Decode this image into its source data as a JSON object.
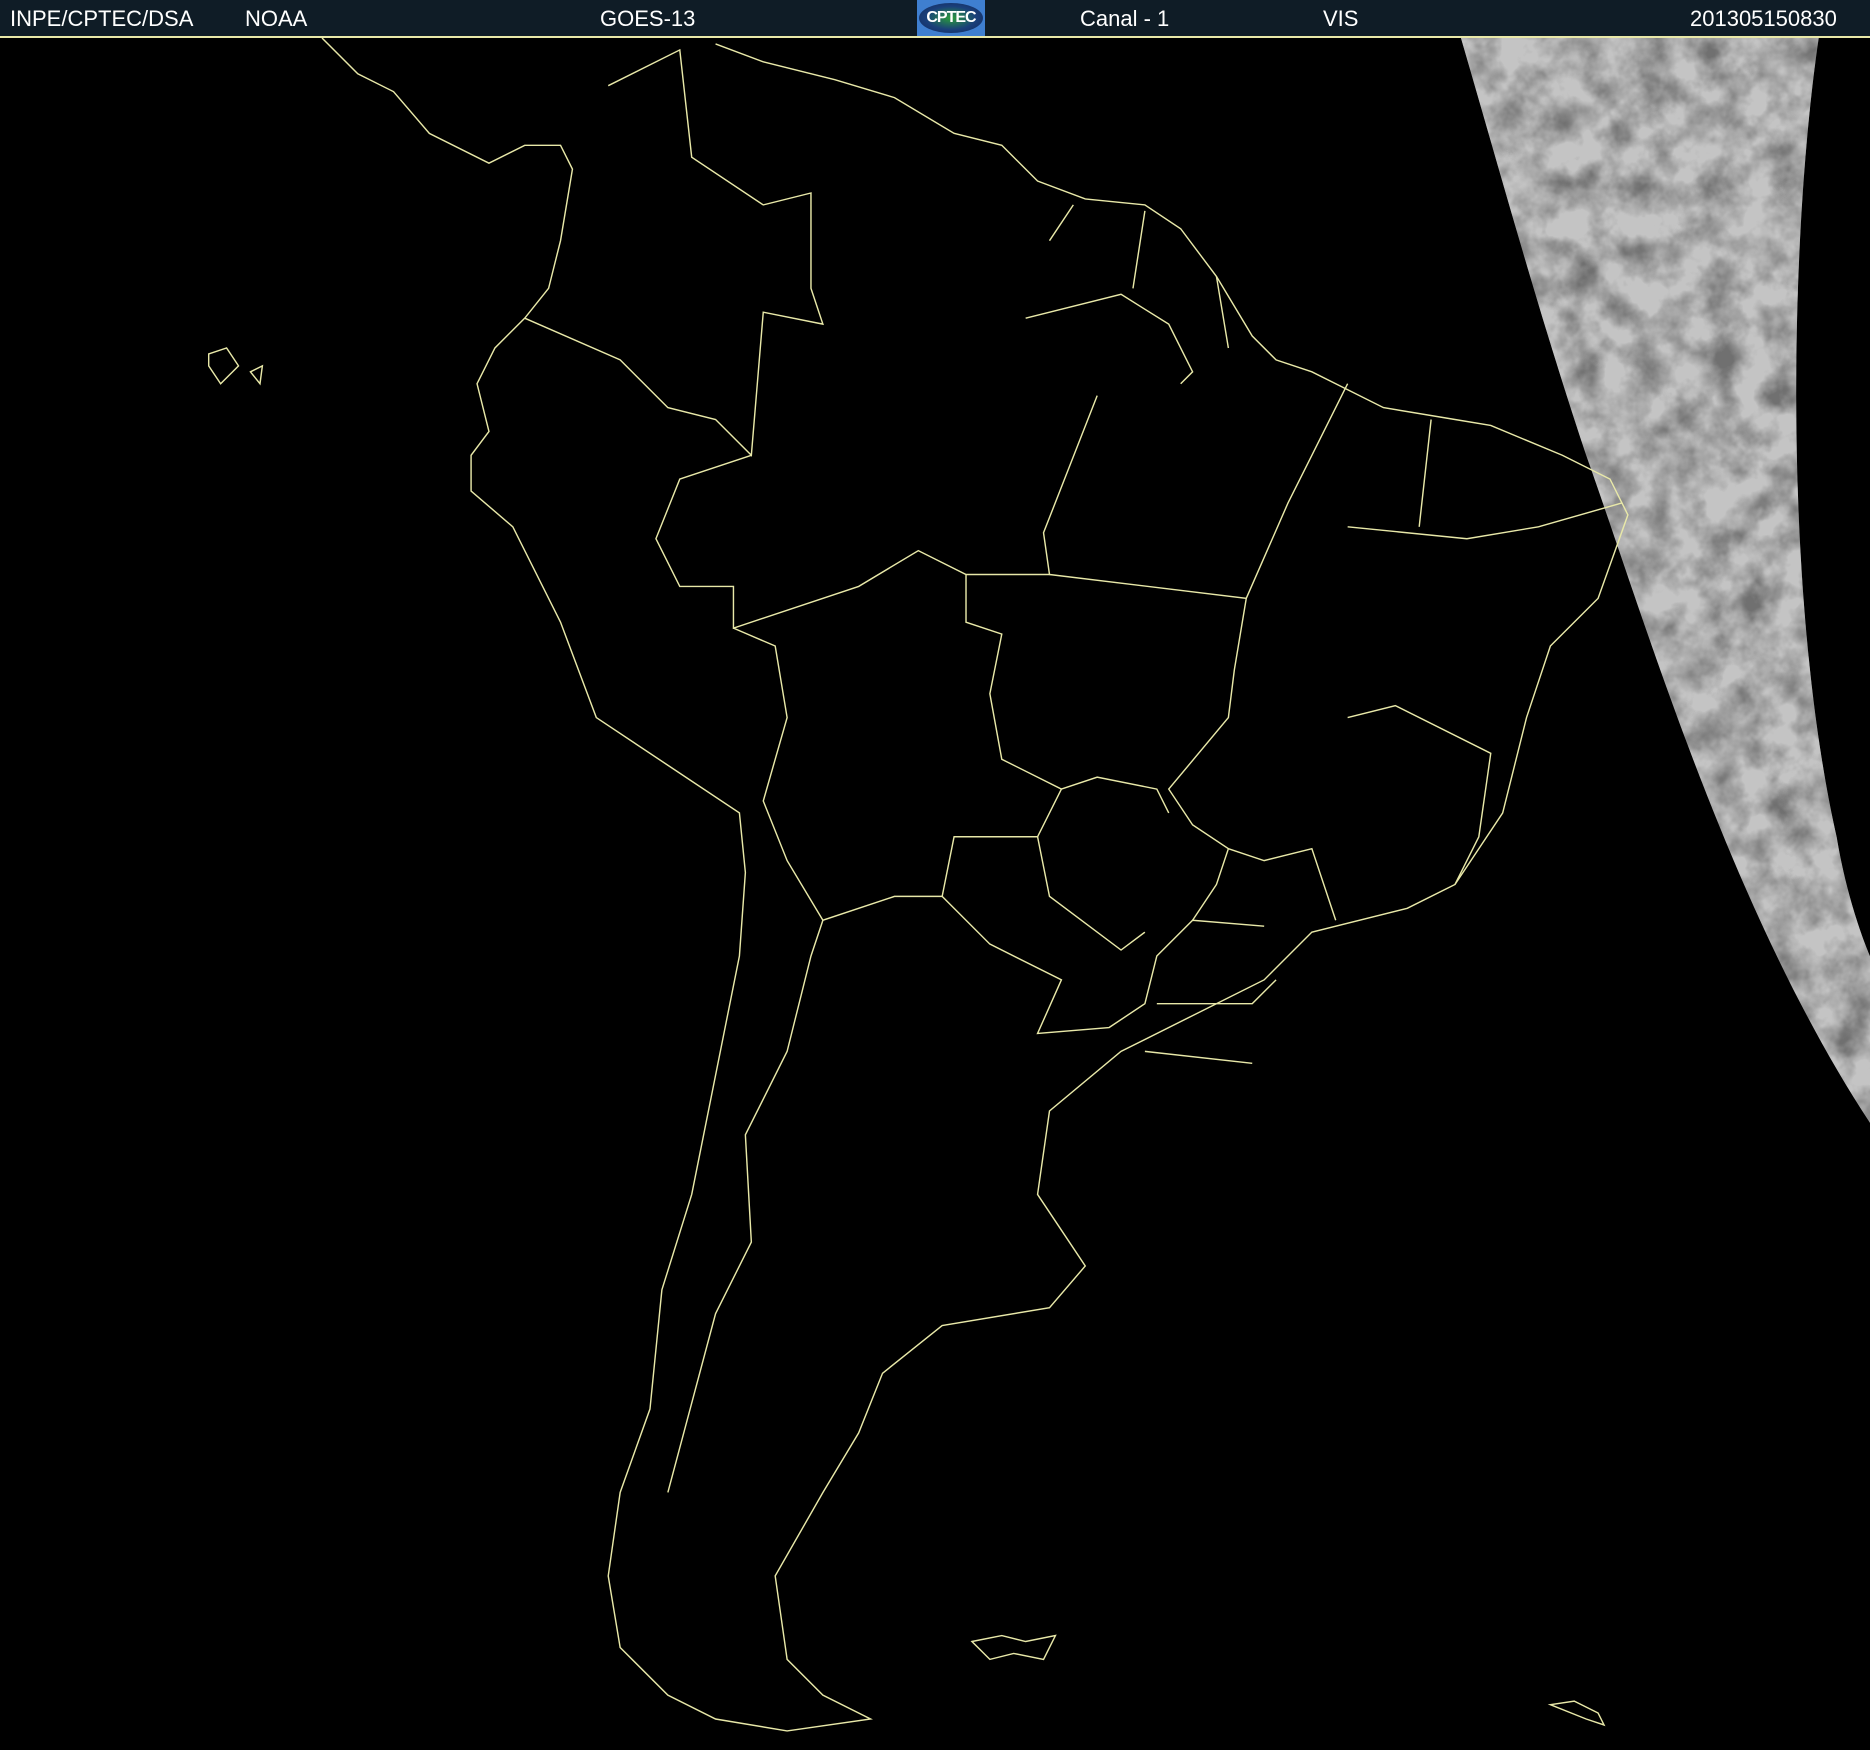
{
  "header": {
    "institution": "INPE/CPTEC/DSA",
    "agency": "NOAA",
    "satellite": "GOES-13",
    "logo_text": "CPTEC",
    "channel": "Canal - 1",
    "band": "VIS",
    "timestamp": "201305150830"
  },
  "colors": {
    "header_bg": "#0f1c26",
    "boundary_line": "#e8e8a8",
    "background": "#000000"
  }
}
